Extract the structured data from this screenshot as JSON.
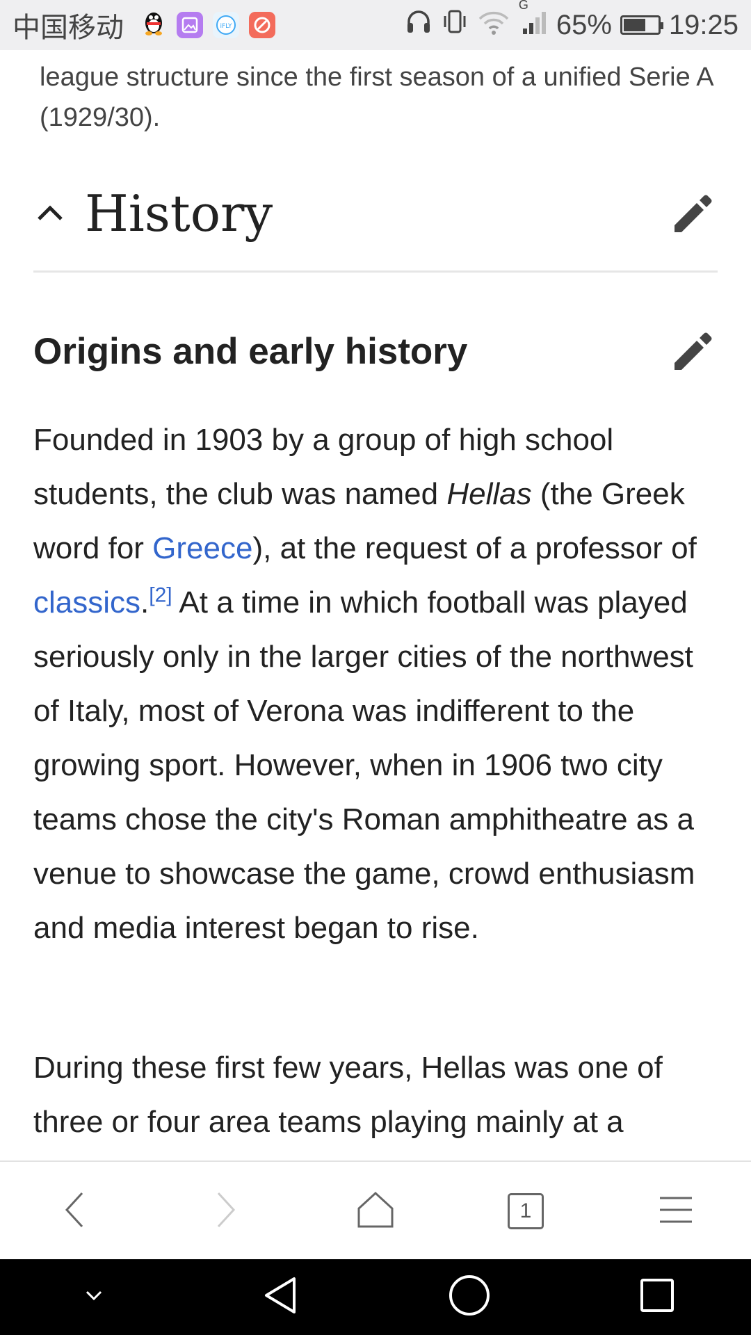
{
  "status_bar": {
    "carrier": "中国移动",
    "battery_text": "65%",
    "battery_level": 0.65,
    "time": "19:25",
    "network_type": "G",
    "app_icons": [
      "qq-icon",
      "gallery-icon",
      "ifly-icon",
      "tool-icon"
    ],
    "app_icon_colors": [
      "#000000",
      "#b57cf0",
      "#3fa9f5",
      "#f36b5b"
    ]
  },
  "article": {
    "intro_fragment": "league structure since the first season of a unified Serie A (1929/30).",
    "section_title": "History",
    "subsection_title": "Origins and early history",
    "p1": {
      "t1": "Founded in 1903 by a group of high school students, the club was named ",
      "italic": "Hellas",
      "t2": " (the Greek word for ",
      "link1": "Greece",
      "t3": "), at the request of a professor of ",
      "link2": "classics",
      "t4": ".",
      "ref": "[2]",
      "t5": " At a time in which football was played seriously only in the larger cities of the northwest of Italy, most of Verona was indifferent to the growing sport. However, when in 1906 two city teams chose the city's Roman amphitheatre as a venue to showcase the game, crowd enthusiasm and media interest began to rise."
    },
    "p2": "During these first few years, Hellas was one of three or four area teams playing mainly at a"
  },
  "toolbar": {
    "tab_count": "1"
  },
  "colors": {
    "link": "#3366cc",
    "status_bg": "#efeff1",
    "nav_bg": "#000000"
  }
}
